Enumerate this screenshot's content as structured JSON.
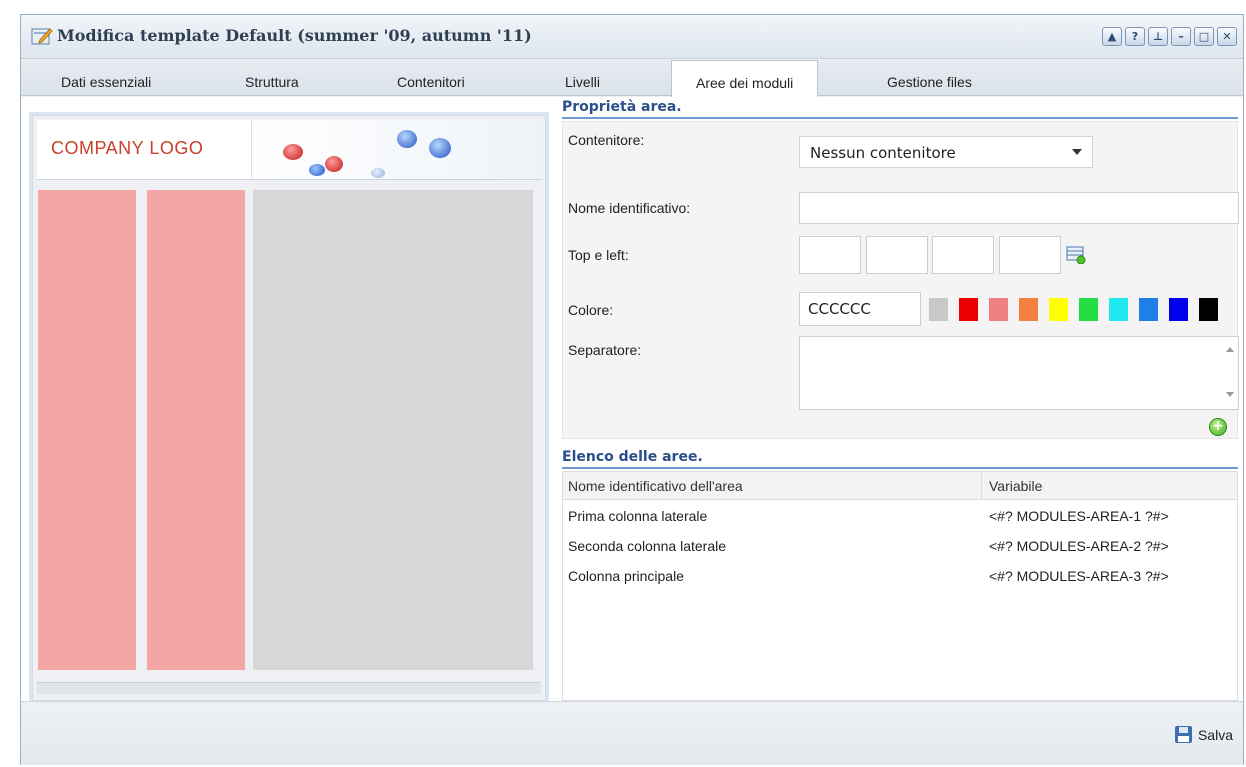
{
  "window": {
    "title": "Modifica template Default (summer '09, autumn '11)",
    "controls": [
      "collapse-icon",
      "help-icon",
      "pin-icon",
      "minimize-icon",
      "maximize-icon",
      "close-icon"
    ]
  },
  "tabs": [
    {
      "label": "Dati essenziali",
      "active": false
    },
    {
      "label": "Struttura",
      "active": false
    },
    {
      "label": "Contenitori",
      "active": false
    },
    {
      "label": "Livelli",
      "active": false
    },
    {
      "label": "Aree dei moduli",
      "active": true
    },
    {
      "label": "Gestione files",
      "active": false
    }
  ],
  "preview": {
    "logo_text": "COMPANY LOGO",
    "column_colors": {
      "side": "#f4a6a4",
      "main": "#d7d7d7"
    }
  },
  "properties": {
    "section_title": "Proprietà area.",
    "container_label": "Contenitore:",
    "container_value": "Nessun contenitore",
    "name_label": "Nome identificativo:",
    "name_value": "",
    "topleft_label": "Top e left:",
    "color_label": "Colore:",
    "color_value": "CCCCCC",
    "swatches": [
      "#c8c8c8",
      "#ee0000",
      "#f08080",
      "#f48040",
      "#ffff00",
      "#22dd44",
      "#22e8f0",
      "#1f7fe8",
      "#0000ee",
      "#000000"
    ],
    "separator_label": "Separatore:"
  },
  "areas": {
    "section_title": "Elenco delle aree.",
    "col_name": "Nome identificativo dell'area",
    "col_var": "Variabile",
    "rows": [
      {
        "name": "Prima colonna laterale",
        "var": "<#? MODULES-AREA-1 ?#>"
      },
      {
        "name": "Seconda colonna laterale",
        "var": "<#? MODULES-AREA-2 ?#>"
      },
      {
        "name": "Colonna principale",
        "var": "<#? MODULES-AREA-3 ?#>"
      }
    ]
  },
  "footer": {
    "save_label": "Salva"
  }
}
